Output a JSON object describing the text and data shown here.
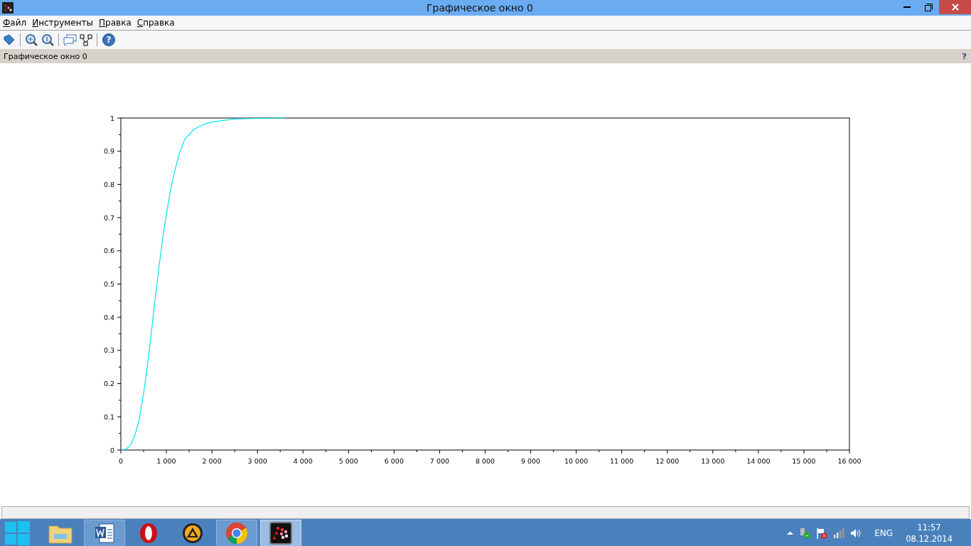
{
  "window": {
    "title": "Графическое окно 0"
  },
  "menu": [
    {
      "label": "Файл"
    },
    {
      "label": "Инструменты"
    },
    {
      "label": "Правка"
    },
    {
      "label": "Справка"
    }
  ],
  "toolbar": [
    {
      "kind": "rotate"
    },
    {
      "kind": "sep"
    },
    {
      "kind": "zoom"
    },
    {
      "kind": "zoom-reset"
    },
    {
      "kind": "sep"
    },
    {
      "kind": "datatip"
    },
    {
      "kind": "editor"
    },
    {
      "kind": "sep"
    },
    {
      "kind": "help",
      "label": "?"
    }
  ],
  "panel": {
    "title": "Графическое окно 0",
    "help": "?"
  },
  "chart_data": {
    "type": "line",
    "xlim": [
      0,
      16000
    ],
    "ylim": [
      0,
      1
    ],
    "xticks": [
      0,
      {
        "value": 1000,
        "label": "1 000"
      },
      {
        "value": 2000,
        "label": "2 000"
      },
      {
        "value": 3000,
        "label": "3 000"
      },
      {
        "value": 4000,
        "label": "4 000"
      },
      {
        "value": 5000,
        "label": "5 000"
      },
      {
        "value": 6000,
        "label": "6 000"
      },
      {
        "value": 7000,
        "label": "7 000"
      },
      {
        "value": 8000,
        "label": "8 000"
      },
      {
        "value": 9000,
        "label": "9 000"
      },
      {
        "value": 10000,
        "label": "10 000"
      },
      {
        "value": 11000,
        "label": "11 000"
      },
      {
        "value": 12000,
        "label": "12 000"
      },
      {
        "value": 13000,
        "label": "13 000"
      },
      {
        "value": 14000,
        "label": "14 000"
      },
      {
        "value": 15000,
        "label": "15 000"
      },
      {
        "value": 16000,
        "label": "16 000"
      }
    ],
    "yticks": [
      0,
      0.1,
      0.2,
      0.3,
      0.4,
      0.5,
      0.6,
      0.7,
      0.8,
      0.9,
      1
    ],
    "x": [
      0,
      100,
      200,
      300,
      400,
      500,
      600,
      700,
      800,
      900,
      1000,
      1100,
      1200,
      1300,
      1400,
      1600,
      1800,
      2000,
      2500,
      3000,
      3600
    ],
    "series": [
      {
        "color": "#00e5ee",
        "values": [
          0,
          0.002,
          0.012,
          0.04,
          0.09,
          0.17,
          0.27,
          0.39,
          0.51,
          0.62,
          0.71,
          0.79,
          0.85,
          0.9,
          0.935,
          0.965,
          0.98,
          0.988,
          0.997,
          0.999,
          1
        ]
      }
    ]
  },
  "taskbar": [
    {
      "kind": "start",
      "running": false,
      "selected": false
    },
    {
      "kind": "folder",
      "running": false,
      "selected": false
    },
    {
      "kind": "word",
      "running": true,
      "selected": false
    },
    {
      "kind": "opera",
      "running": false,
      "selected": false
    },
    {
      "kind": "aimp",
      "running": false,
      "selected": false
    },
    {
      "kind": "chrome",
      "running": true,
      "selected": false
    },
    {
      "kind": "scilab",
      "running": true,
      "selected": true
    }
  ],
  "tray": {
    "language": "ENG",
    "time": "11:57",
    "date": "08.12.2014"
  }
}
